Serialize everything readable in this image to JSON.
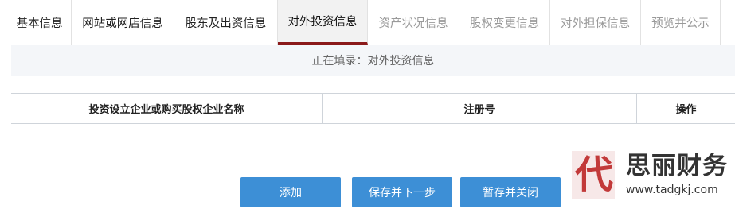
{
  "tabs": [
    {
      "label": "基本信息",
      "state": "normal"
    },
    {
      "label": "网站或网店信息",
      "state": "normal"
    },
    {
      "label": "股东及出资信息",
      "state": "normal"
    },
    {
      "label": "对外投资信息",
      "state": "active"
    },
    {
      "label": "资产状况信息",
      "state": "disabled"
    },
    {
      "label": "股权变更信息",
      "state": "disabled"
    },
    {
      "label": "对外担保信息",
      "state": "disabled"
    },
    {
      "label": "预览并公示",
      "state": "disabled"
    }
  ],
  "status": {
    "text": "正在填录：对外投资信息"
  },
  "table": {
    "columns": [
      "投资设立企业或购买股权企业名称",
      "注册号",
      "操作"
    ],
    "rows": []
  },
  "buttons": {
    "add": "添加",
    "save_next": "保存并下一步",
    "save_close": "暂存并关闭"
  },
  "watermark": {
    "char": "代",
    "name": "思丽财务",
    "url": "www.tadgkj.com"
  },
  "colors": {
    "active_tab_underline": "#8b1a1a",
    "button_bg": "#3d8fd6",
    "status_bg": "#f4f6f9"
  }
}
